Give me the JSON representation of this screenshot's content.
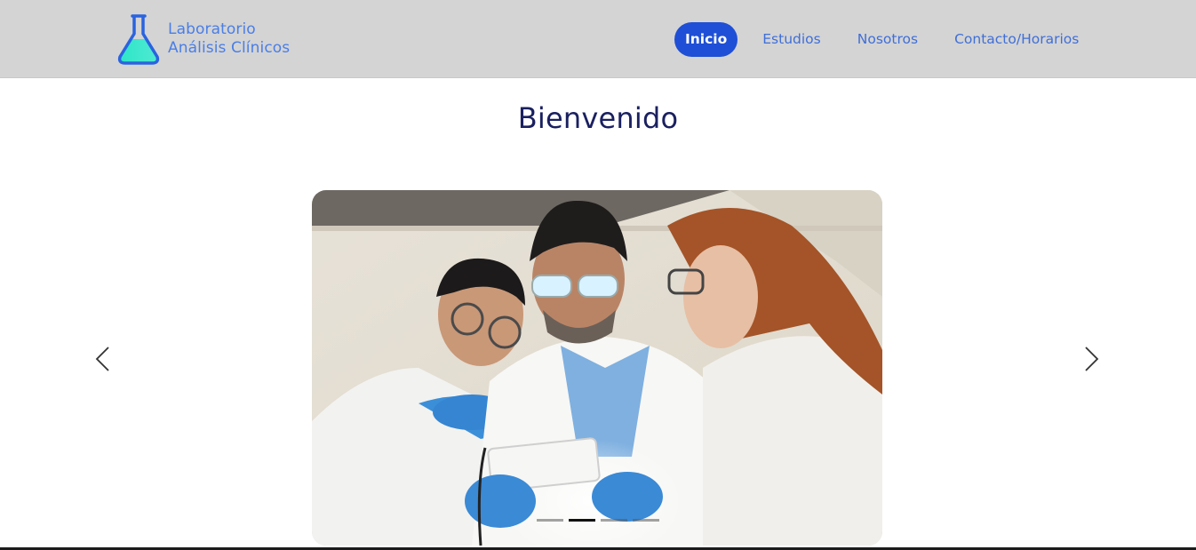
{
  "brand": {
    "line1": "Laboratorio",
    "line2": "Análisis Clínicos",
    "logo_icon": "flask-icon"
  },
  "nav": {
    "items": [
      {
        "label": "Inicio",
        "active": true
      },
      {
        "label": "Estudios",
        "active": false
      },
      {
        "label": "Nosotros",
        "active": false
      },
      {
        "label": "Contacto/Horarios",
        "active": false
      }
    ]
  },
  "main": {
    "title": "Bienvenido"
  },
  "carousel": {
    "prev_icon": "chevron-left-icon",
    "next_icon": "chevron-right-icon",
    "slide_count": 4,
    "active_index": 1
  },
  "colors": {
    "navbar_bg": "#d4d4d4",
    "nav_link": "#3f6fd8",
    "nav_active_bg": "#1f4fd6",
    "title": "#1a2060",
    "flask_liquid": "#2ee6c8"
  }
}
